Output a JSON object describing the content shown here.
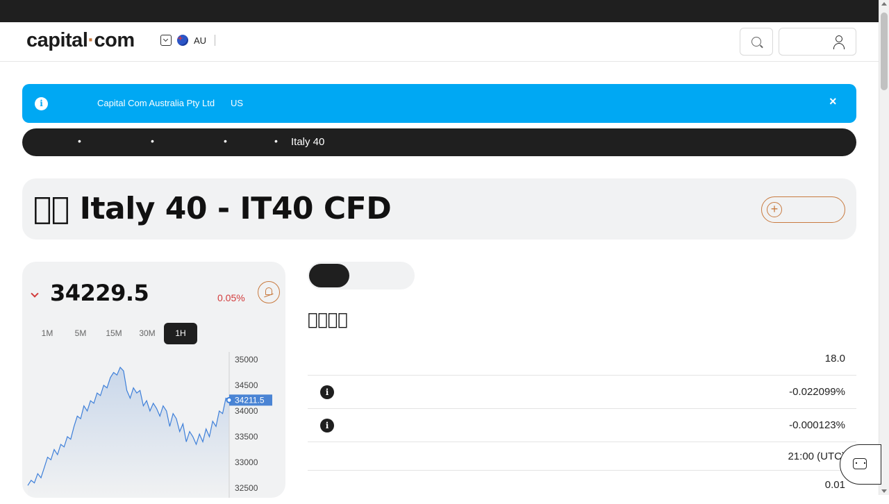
{
  "header": {
    "logo_main": "capital",
    "logo_dot": "·",
    "logo_tld": "com",
    "region_code": "AU"
  },
  "banner": {
    "company": "Capital Com Australia Pty Ltd",
    "country": "US",
    "close": "×",
    "info": "i"
  },
  "breadcrumb": {
    "current": "Italy 40",
    "separator": "•"
  },
  "title": {
    "text": "\u0000\u0000 Italy 40 - IT40 CFD"
  },
  "watch": {
    "plus": "+"
  },
  "quote": {
    "price": "34229.5",
    "change": "0.05%",
    "timeframes": [
      "1M",
      "5M",
      "15M",
      "30M",
      "1H"
    ],
    "active_timeframe": "1H"
  },
  "chart_data": {
    "type": "area",
    "y_ticks": [
      "35000",
      "34500",
      "34000",
      "33500",
      "33000",
      "32500"
    ],
    "current_value_label": "34211.5",
    "ylim": [
      32500,
      35000
    ],
    "values": [
      32550,
      32650,
      32600,
      32780,
      32700,
      32900,
      33100,
      33050,
      33250,
      33150,
      33350,
      33300,
      33500,
      33450,
      33700,
      33900,
      33850,
      34100,
      34000,
      34200,
      34150,
      34350,
      34300,
      34500,
      34450,
      34650,
      34750,
      34700,
      34850,
      34780,
      34400,
      34250,
      34450,
      34350,
      34400,
      34100,
      34200,
      34000,
      34150,
      34050,
      33900,
      34100,
      34000,
      33700,
      33950,
      33850,
      33600,
      33750,
      33400,
      33600,
      33500,
      33350,
      33550,
      33400,
      33650,
      33500,
      33800,
      33700,
      34000,
      33950,
      34250,
      34211.5
    ],
    "colors": {
      "line": "#3d7fd9",
      "area_top": "#c9d7ea",
      "area_bottom": "#f1f2f3",
      "label_bg": "#4a84d4"
    }
  },
  "details": {
    "section_title": "\u0000\u0000\u0000\u0000",
    "rows": [
      {
        "value": "18.0",
        "info": false
      },
      {
        "value": "-0.022099%",
        "info": true
      },
      {
        "value": "-0.000123%",
        "info": true
      },
      {
        "value": "21:00 (UTC)",
        "info": false
      },
      {
        "value": "0.01",
        "info": false
      }
    ]
  },
  "icons": {
    "search": "search-icon",
    "account": "user-icon",
    "chat": "chat-icon",
    "bell": "bell-icon"
  }
}
